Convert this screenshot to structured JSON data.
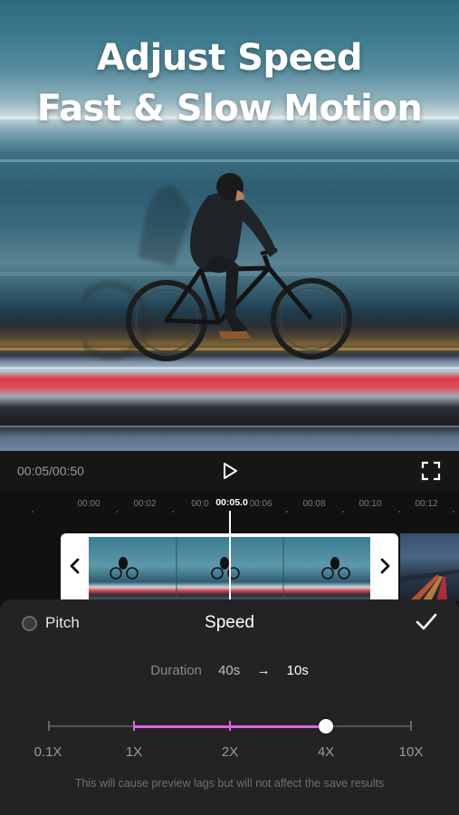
{
  "hero": {
    "title_line1": "Adjust Speed",
    "title_line2": "Fast & Slow Motion"
  },
  "player": {
    "time": "00:05/00:50",
    "play_icon": "play-icon",
    "fullscreen_icon": "fullscreen-icon"
  },
  "timeline": {
    "ticks": [
      "00:00",
      "00:02",
      "00:0",
      "00:05",
      "00:06",
      "00:08",
      "00:10",
      "00:12"
    ],
    "current_time": "00:05.0"
  },
  "speed_panel": {
    "pitch_label": "Pitch",
    "title": "Speed",
    "confirm_icon": "checkmark-icon",
    "duration_label": "Duration",
    "duration_original": "40s",
    "duration_arrow": "→",
    "duration_new": "10s",
    "speed_options": [
      "0.1X",
      "1X",
      "2X",
      "4X",
      "10X"
    ],
    "selected_speed": "4X",
    "accent_color": "#e062e6",
    "warning": "This will cause preview lags but will not affect the save results"
  }
}
